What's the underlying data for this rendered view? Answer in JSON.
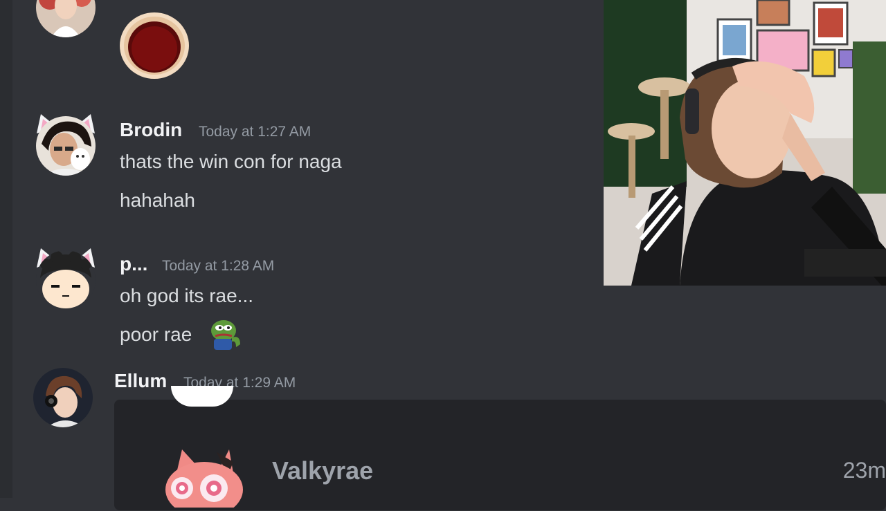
{
  "messages": [
    {
      "username": "Brodin",
      "timestamp": "Today at 1:27 AM",
      "lines": [
        "thats the win con for naga",
        "hahahah"
      ]
    },
    {
      "username": "p...",
      "timestamp": "Today at 1:28 AM",
      "lines": [
        "oh god its rae...",
        "poor rae"
      ]
    },
    {
      "username": "Ellum",
      "timestamp": "Today at 1:29 AM",
      "lines": []
    }
  ],
  "embed": {
    "name": "Valkyrae",
    "time": "23m"
  },
  "emojis": {
    "message0": "hole-emoji",
    "poor_rae": "pepe-emoji"
  },
  "colors": {
    "background": "#313338",
    "username": "#f2f3f5",
    "timestamp": "#949ba4",
    "text": "#dbdee1",
    "embed_bg": "#232428"
  }
}
